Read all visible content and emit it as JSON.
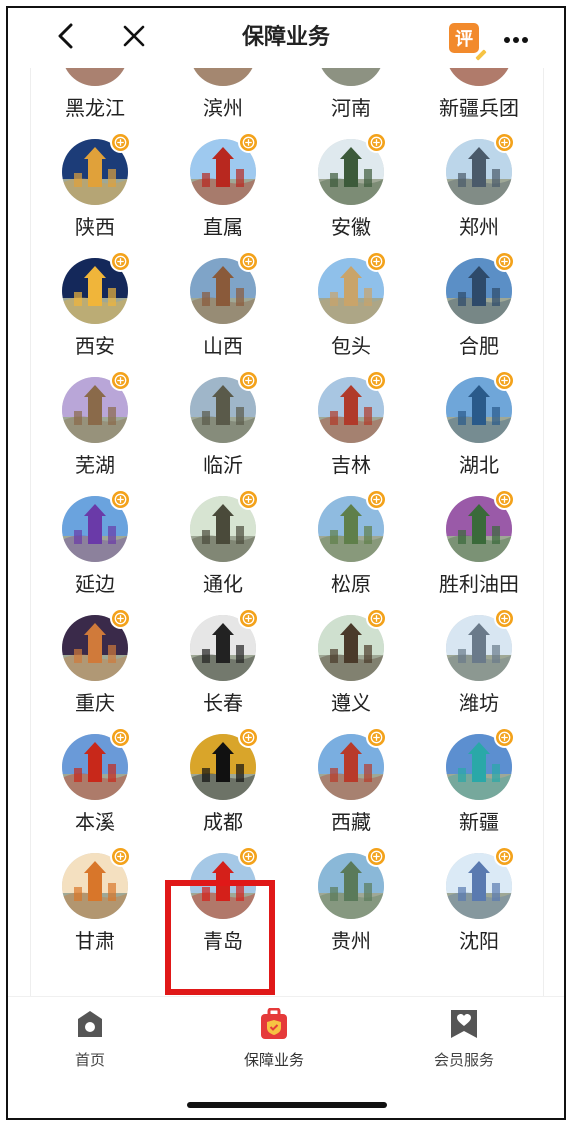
{
  "nav": {
    "title": "保障业务",
    "rate_label": "评"
  },
  "colors": {
    "accent": "#f3a21b",
    "active_tab": "#e53a3a",
    "highlight": "#e01818"
  },
  "grid": {
    "items": [
      {
        "label": "黑龙江",
        "icon": "harbin-tower-thumb",
        "c1": "#e9eef5",
        "c2": "#c0392b"
      },
      {
        "label": "滨州",
        "icon": "pavilion-thumb",
        "c1": "#7fb8e8",
        "c2": "#b04a2a"
      },
      {
        "label": "河南",
        "icon": "ruins-thumb",
        "c1": "#9cb7d6",
        "c2": "#6e6a5e"
      },
      {
        "label": "新疆兵团",
        "icon": "red-flag-thumb",
        "c1": "#f5e6d6",
        "c2": "#d0271d"
      },
      {
        "label": "陕西",
        "icon": "bell-tower-thumb",
        "c1": "#1c3c78",
        "c2": "#e0a13a"
      },
      {
        "label": "直属",
        "icon": "tiananmen-thumb",
        "c1": "#9ec9ef",
        "c2": "#b8281f"
      },
      {
        "label": "安徽",
        "icon": "pine-thumb",
        "c1": "#dfe9ee",
        "c2": "#3c5a3a"
      },
      {
        "label": "郑州",
        "icon": "tower-thumb",
        "c1": "#bcd6ea",
        "c2": "#4a5a6a"
      },
      {
        "label": "西安",
        "icon": "night-pagoda-thumb",
        "c1": "#14285a",
        "c2": "#f0b53a"
      },
      {
        "label": "山西",
        "icon": "twin-pagoda-thumb",
        "c1": "#7fa4c8",
        "c2": "#8a5a3a"
      },
      {
        "label": "包头",
        "icon": "building-thumb",
        "c1": "#8fc0ea",
        "c2": "#c9a46a"
      },
      {
        "label": "合肥",
        "icon": "skyscraper-thumb",
        "c1": "#5b8fc6",
        "c2": "#2e4a6a"
      },
      {
        "label": "芜湖",
        "icon": "flower-tower-thumb",
        "c1": "#b9a6d8",
        "c2": "#8a6a4a"
      },
      {
        "label": "临沂",
        "icon": "rock-thumb",
        "c1": "#9fb6c9",
        "c2": "#5a5a4a"
      },
      {
        "label": "吉林",
        "icon": "statue-city-thumb",
        "c1": "#a8c6e2",
        "c2": "#b03a2a"
      },
      {
        "label": "湖北",
        "icon": "city-skyline-thumb",
        "c1": "#6fa6d9",
        "c2": "#2a5a8a"
      },
      {
        "label": "延边",
        "icon": "lake-thumb",
        "c1": "#6aa3de",
        "c2": "#6a3aa8"
      },
      {
        "label": "通化",
        "icon": "monument-thumb",
        "c1": "#d7e4d2",
        "c2": "#4a4a3a"
      },
      {
        "label": "松原",
        "icon": "river-thumb",
        "c1": "#8fbbe0",
        "c2": "#5f7f4a"
      },
      {
        "label": "胜利油田",
        "icon": "oilfield-thumb",
        "c1": "#9a5aa8",
        "c2": "#3a6a3a"
      },
      {
        "label": "重庆",
        "icon": "night-city-thumb",
        "c1": "#3a2a4a",
        "c2": "#d07a3a"
      },
      {
        "label": "长春",
        "icon": "classic-car-thumb",
        "c1": "#e6e6e6",
        "c2": "#222222"
      },
      {
        "label": "遵义",
        "icon": "historic-house-thumb",
        "c1": "#cfe0cf",
        "c2": "#4a3a2a"
      },
      {
        "label": "潍坊",
        "icon": "kite-building-thumb",
        "c1": "#d8e6f2",
        "c2": "#6a7a8a"
      },
      {
        "label": "本溪",
        "icon": "red-maple-thumb",
        "c1": "#6a9ad8",
        "c2": "#c8281a"
      },
      {
        "label": "成都",
        "icon": "panda-thumb",
        "c1": "#d9a52a",
        "c2": "#111111"
      },
      {
        "label": "西藏",
        "icon": "potala-thumb",
        "c1": "#7aaee0",
        "c2": "#b83a2a"
      },
      {
        "label": "新疆",
        "icon": "mountain-lake-thumb",
        "c1": "#5c8fd0",
        "c2": "#2aa8a8"
      },
      {
        "label": "甘肃",
        "icon": "illustrated-tower-thumb",
        "c1": "#f4e0c0",
        "c2": "#d8762a"
      },
      {
        "label": "青岛",
        "icon": "red-sculpture-thumb",
        "c1": "#a5c8e6",
        "c2": "#d4201a"
      },
      {
        "label": "贵州",
        "icon": "waterfall-thumb",
        "c1": "#8ab8d8",
        "c2": "#5a7a5a"
      },
      {
        "label": "沈阳",
        "icon": "map-aircraft-carrier-thumb",
        "c1": "#dbeaf6",
        "c2": "#5a7ab0"
      }
    ]
  },
  "tabs": [
    {
      "label": "首页",
      "icon": "home-icon"
    },
    {
      "label": "保障业务",
      "icon": "shield-bag-icon"
    },
    {
      "label": "会员服务",
      "icon": "member-heart-icon"
    }
  ]
}
